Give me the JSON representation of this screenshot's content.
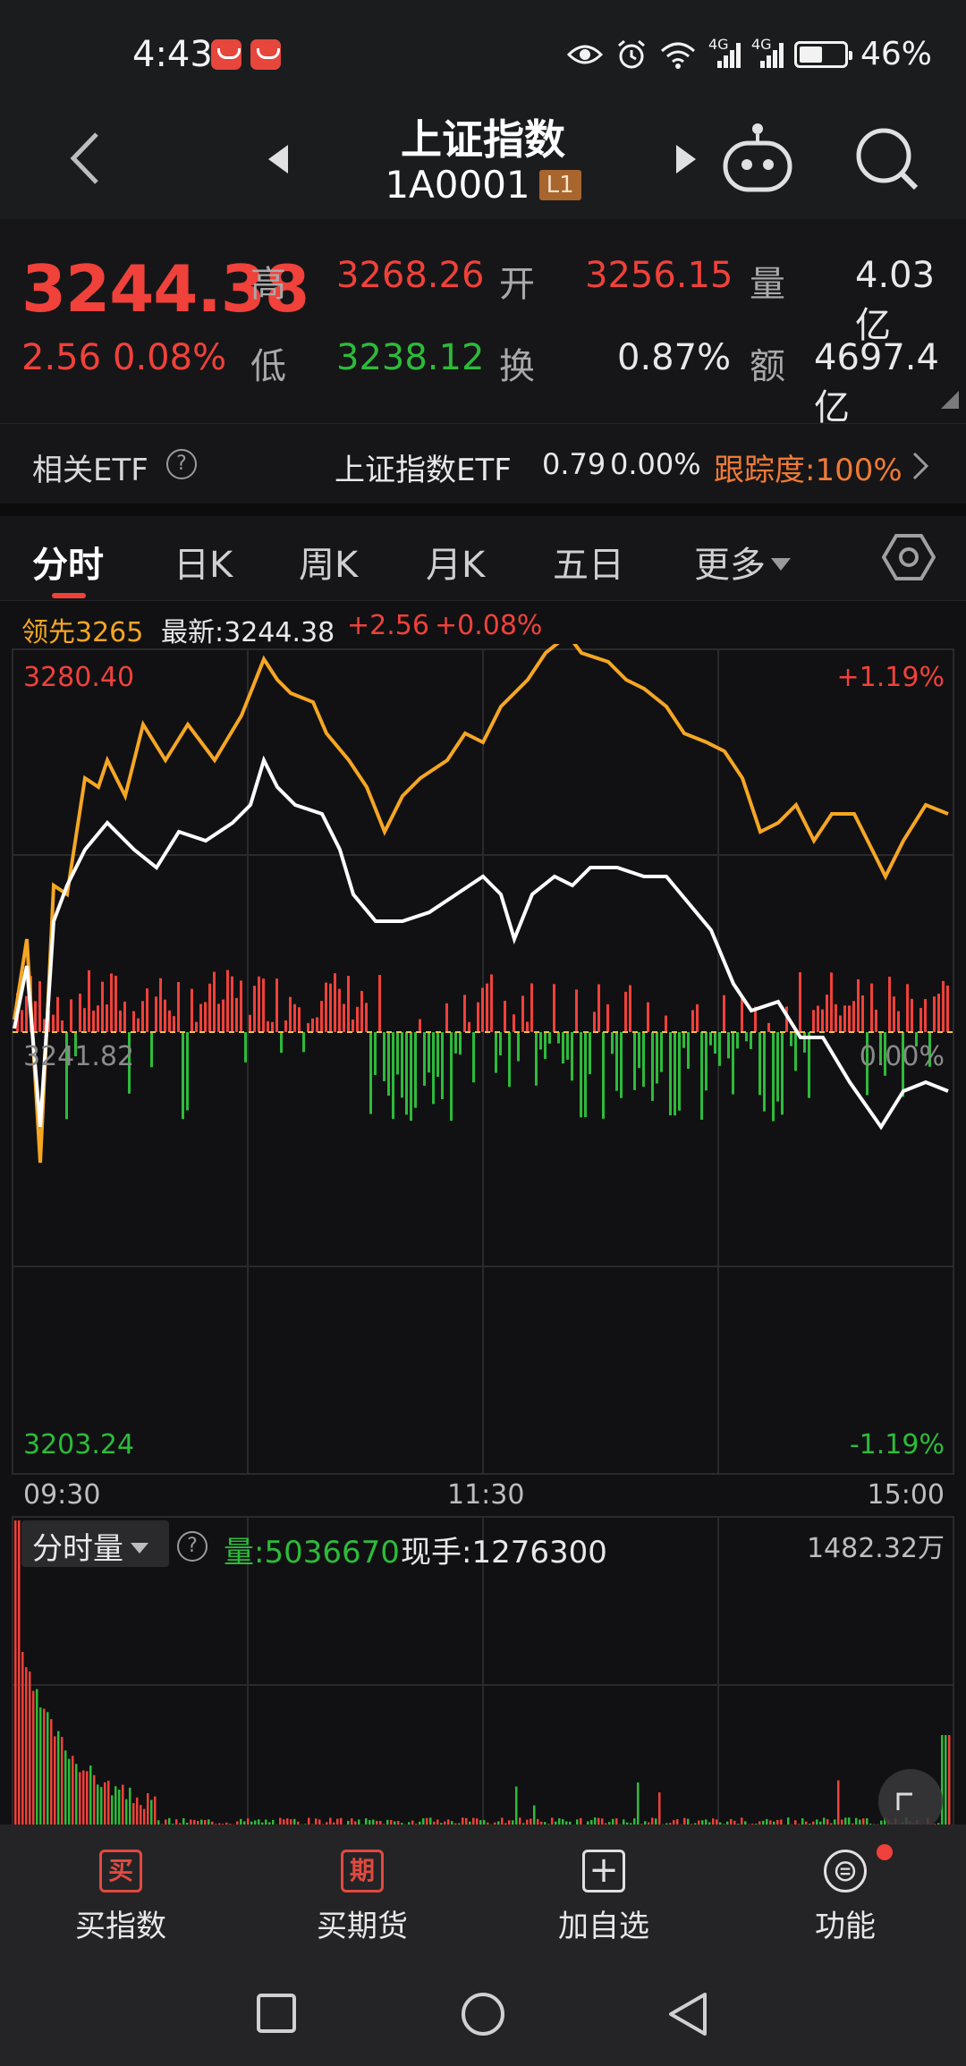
{
  "status": {
    "time": "4:43",
    "battery": "46%",
    "net_a": "4G",
    "net_b": "4G"
  },
  "header": {
    "title": "上证指数",
    "code": "1A0001",
    "level": "L1"
  },
  "quote": {
    "price": "3244.38",
    "change": "2.56",
    "change_pct": "0.08%",
    "high_label": "高",
    "high": "3268.26",
    "open_label": "开",
    "open": "3256.15",
    "vol_label": "量",
    "vol": "4.03亿",
    "low_label": "低",
    "low": "3238.12",
    "turnover_label": "换",
    "turnover": "0.87%",
    "amount_label": "额",
    "amount": "4697.4亿"
  },
  "etf": {
    "label": "相关ETF",
    "name": "上证指数ETF",
    "price": "0.79",
    "pct": "0.00%",
    "track": "跟踪度:100%"
  },
  "tabs": [
    "分时",
    "日K",
    "周K",
    "月K",
    "五日",
    "更多"
  ],
  "legend": {
    "lead": "领先3265",
    "latest": "最新:3244.38",
    "chg": "+2.56",
    "pct": "+0.08%"
  },
  "axis": {
    "top_val": "3280.40",
    "top_pct": "+1.19%",
    "mid_val": "3241.82",
    "mid_pct": "0.00%",
    "bot_val": "3203.24",
    "bot_pct": "-1.19%",
    "t_start": "09:30",
    "t_mid": "11:30",
    "t_end": "15:00"
  },
  "volume": {
    "mode": "分时量",
    "vol": "量:5036670",
    "hand": "现手:1276300",
    "max": "1482.32万"
  },
  "nav": [
    {
      "icon": "买",
      "label": "买指数"
    },
    {
      "icon": "期",
      "label": "买期货"
    },
    {
      "icon": "+",
      "label": "加自选"
    },
    {
      "icon": "⊜",
      "label": "功能"
    }
  ],
  "colors": {
    "up": "#f0413a",
    "down": "#2dbb3a",
    "lead_line": "#f5a623",
    "price_line": "#ffffff"
  }
}
